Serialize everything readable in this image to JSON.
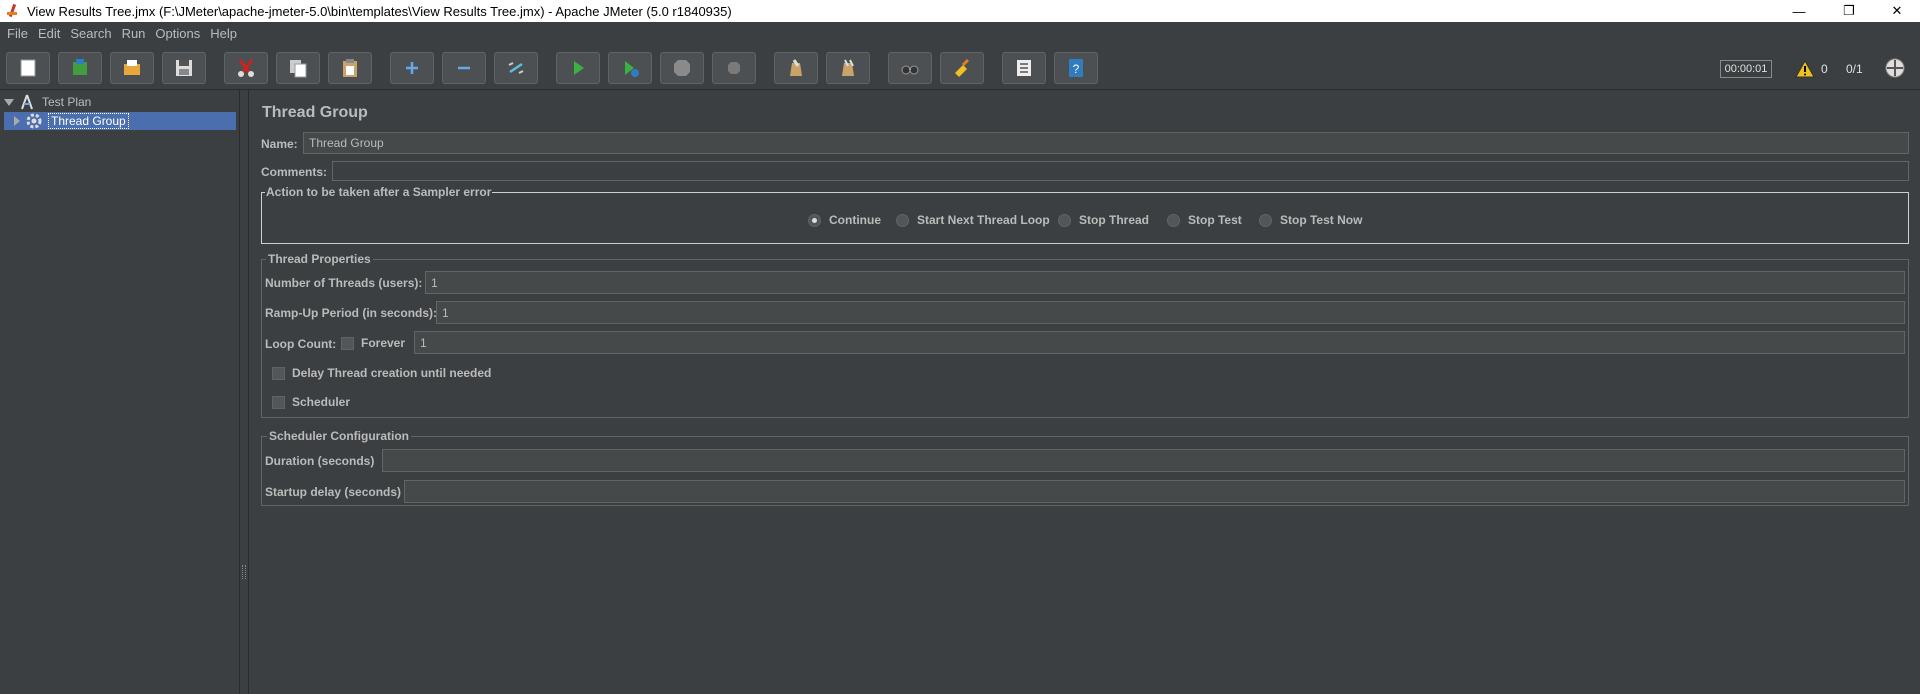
{
  "window": {
    "title": "View Results Tree.jmx (F:\\JMeter\\apache-jmeter-5.0\\bin\\templates\\View Results Tree.jmx) - Apache JMeter (5.0 r1840935)",
    "minimize": "—",
    "restore": "❐",
    "close": "✕"
  },
  "menu": {
    "file": "File",
    "edit": "Edit",
    "search": "Search",
    "run": "Run",
    "options": "Options",
    "help": "Help"
  },
  "toolbar": {
    "timer": "00:00:01",
    "warning_count": "0",
    "threads": "0/1",
    "buttons": [
      "new-icon",
      "templates-icon",
      "open-icon",
      "save-icon",
      "cut-icon",
      "copy-icon",
      "paste-icon",
      "expand-icon",
      "collapse-icon",
      "toggle-icon",
      "start-icon",
      "start-no-pauses-icon",
      "stop-icon",
      "shutdown-icon",
      "clear-icon",
      "clear-all-icon",
      "search-icon",
      "reset-search-icon",
      "function-helper-icon",
      "help-icon"
    ]
  },
  "tree": {
    "root": "Test Plan",
    "child": "Thread Group"
  },
  "panel": {
    "title": "Thread Group",
    "name_label": "Name:",
    "name_value": "Thread Group",
    "comments_label": "Comments:",
    "sampler_error": {
      "legend": "Action to be taken after a Sampler error",
      "options": [
        "Continue",
        "Start Next Thread Loop",
        "Stop Thread",
        "Stop Test",
        "Stop Test Now"
      ],
      "selected": "Continue"
    },
    "thread_properties": {
      "legend": "Thread Properties",
      "threads_label": "Number of Threads (users):",
      "threads_value": "1",
      "rampup_label": "Ramp-Up Period (in seconds):",
      "rampup_value": "1",
      "loop_label": "Loop Count:",
      "forever_label": "Forever",
      "loop_value": "1",
      "delay_label": "Delay Thread creation until needed",
      "scheduler_label": "Scheduler"
    },
    "scheduler_config": {
      "legend": "Scheduler Configuration",
      "duration_label": "Duration (seconds)",
      "duration_value": "",
      "startup_label": "Startup delay (seconds)",
      "startup_value": ""
    }
  },
  "colors": {
    "background": "#3c3f41",
    "selection": "#4b6eaf",
    "text": "#bbbbbb"
  }
}
